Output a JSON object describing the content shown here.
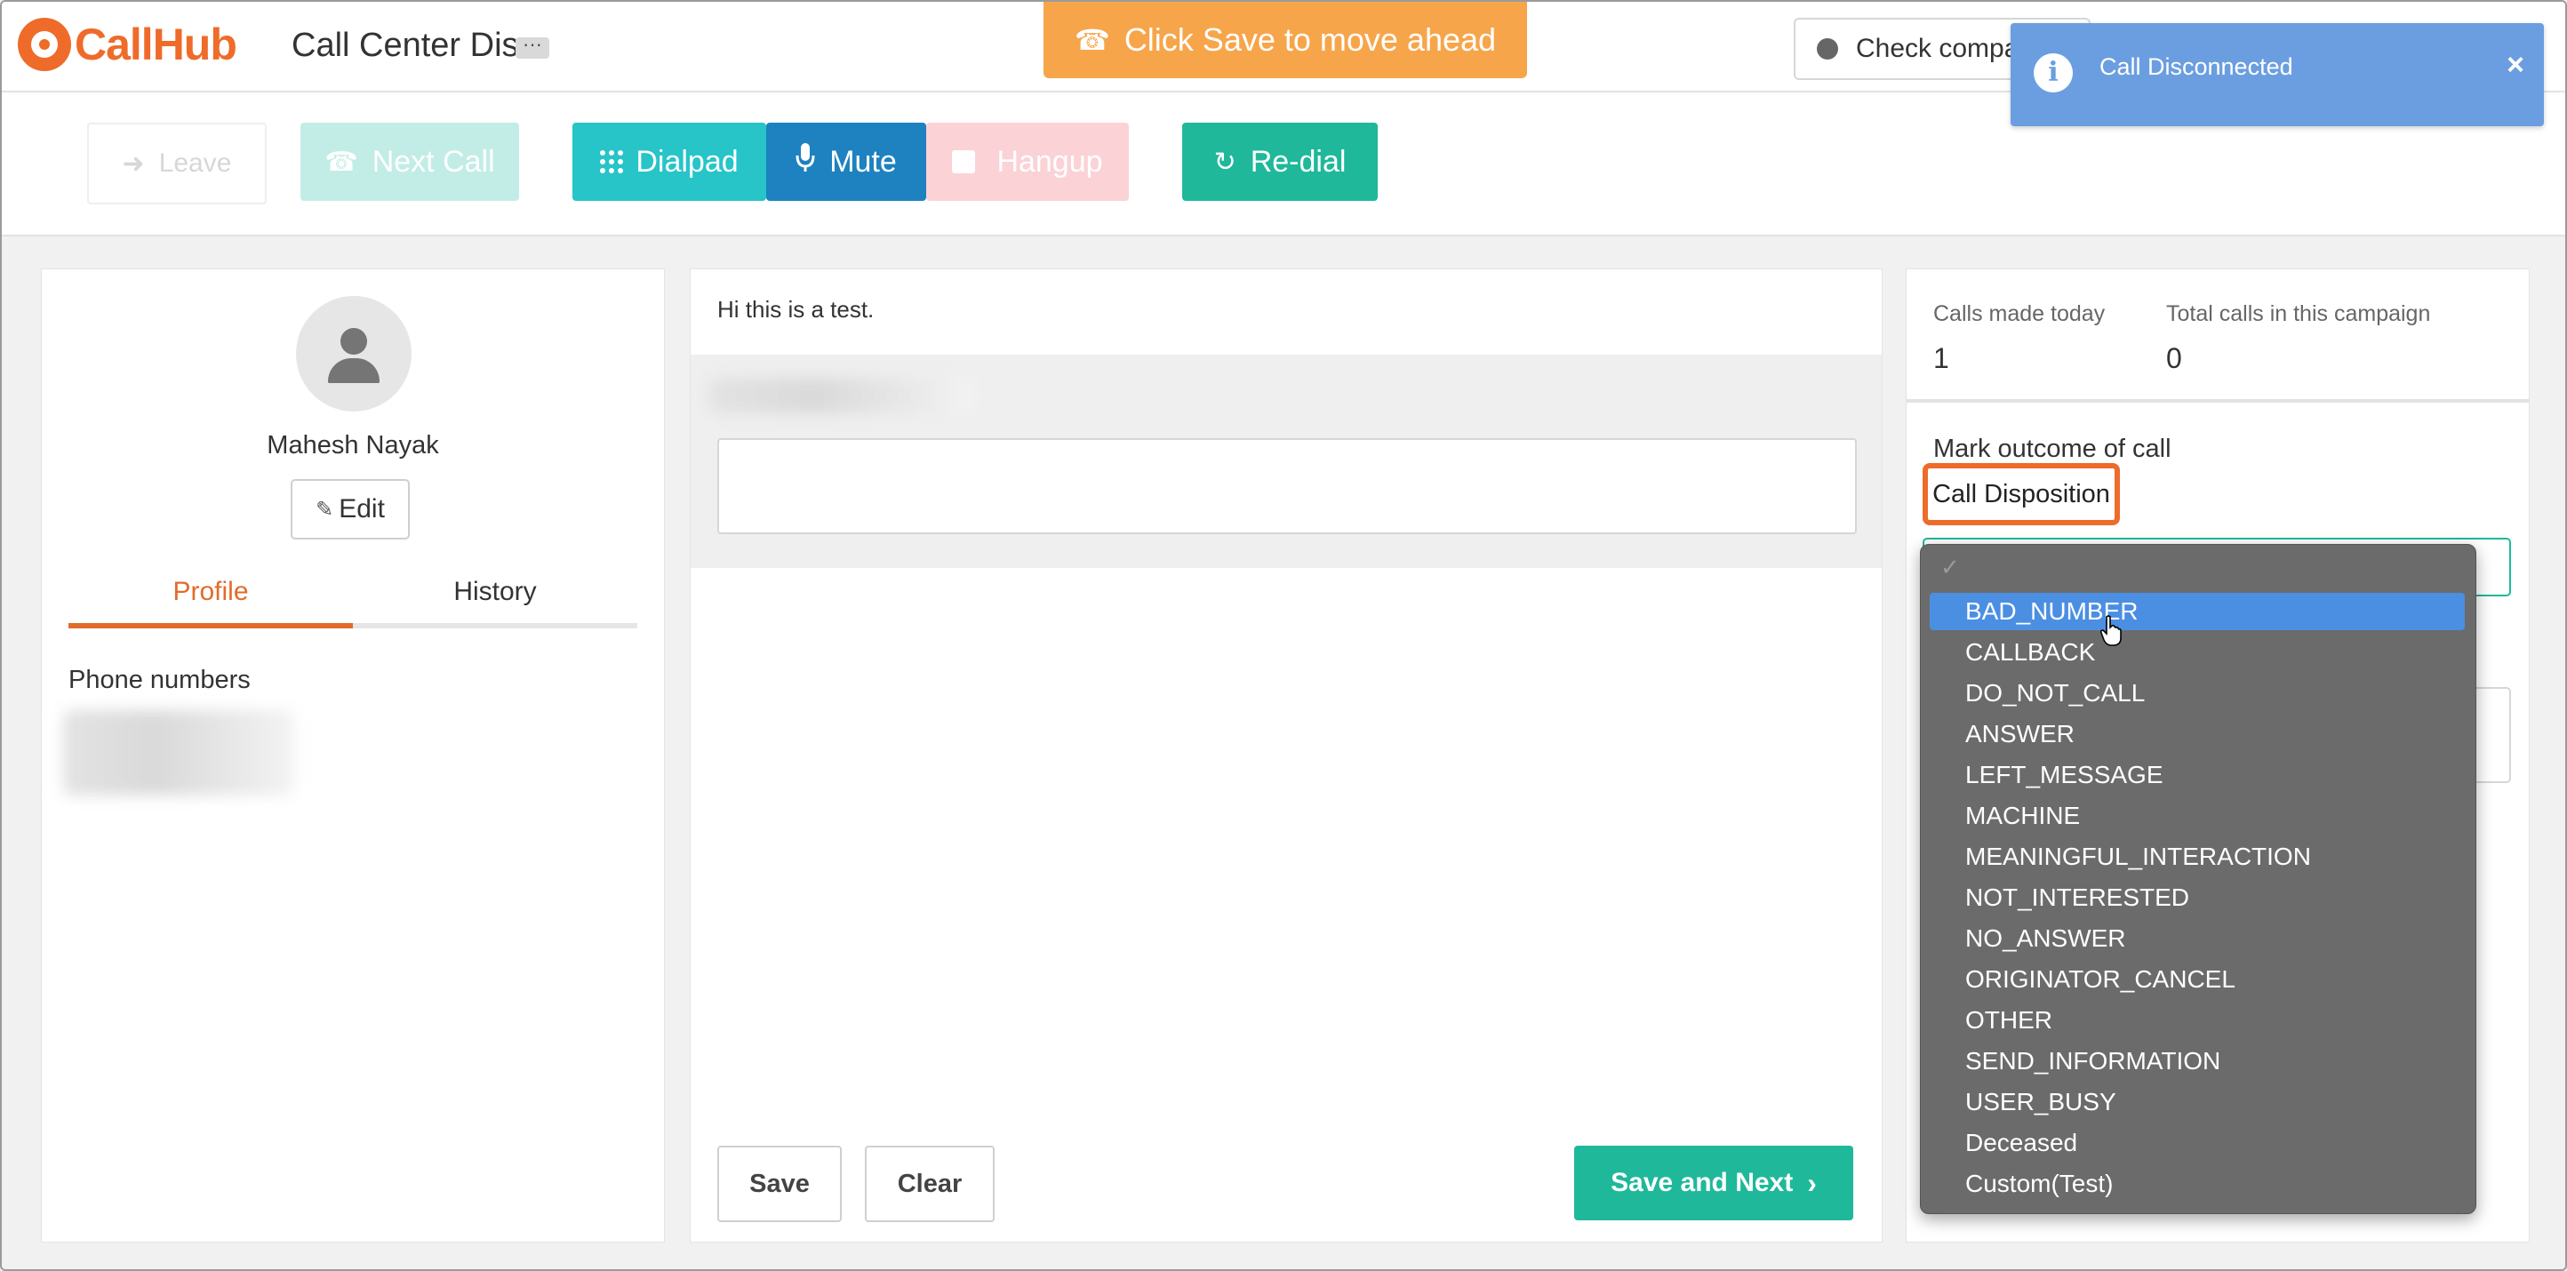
{
  "header": {
    "brand": "CallHub",
    "title": "Call Center Dis",
    "more": "···",
    "banner": "Click Save to move ahead",
    "check_button": "Check compa"
  },
  "toolbar": {
    "leave": "Leave",
    "next_call": "Next Call",
    "dialpad": "Dialpad",
    "mute": "Mute",
    "hangup": "Hangup",
    "redial": "Re-dial"
  },
  "contact": {
    "name": "Mahesh Nayak",
    "edit": "Edit",
    "tabs": [
      "Profile",
      "History"
    ],
    "phone_label": "Phone numbers"
  },
  "script": {
    "text": "Hi this is a test.",
    "save": "Save",
    "clear": "Clear",
    "save_next": "Save and Next"
  },
  "stats": {
    "today_label": "Calls made today",
    "today_value": "1",
    "total_label": "Total calls in this campaign",
    "total_value": "0"
  },
  "outcome": {
    "label": "Mark outcome of call",
    "disposition_label": "Call Disposition",
    "selected": "BAD_NUMBER",
    "options": [
      "BAD_NUMBER",
      "CALLBACK",
      "DO_NOT_CALL",
      "ANSWER",
      "LEFT_MESSAGE",
      "MACHINE",
      "MEANINGFUL_INTERACTION",
      "NOT_INTERESTED",
      "NO_ANSWER",
      "ORIGINATOR_CANCEL",
      "OTHER",
      "SEND_INFORMATION",
      "USER_BUSY",
      "Deceased",
      "Custom(Test)"
    ]
  },
  "toast": {
    "message": "Call Disconnected",
    "close": "×"
  },
  "colors": {
    "brand": "#ef6b2a",
    "primary_green": "#1fb89a",
    "dialpad": "#27c4c8",
    "mute": "#1d82bf",
    "banner": "#f7a54a",
    "toast": "#6a9ee0",
    "dropdown_bg": "#6b6b6b",
    "dropdown_selected": "#4b8fe2"
  }
}
